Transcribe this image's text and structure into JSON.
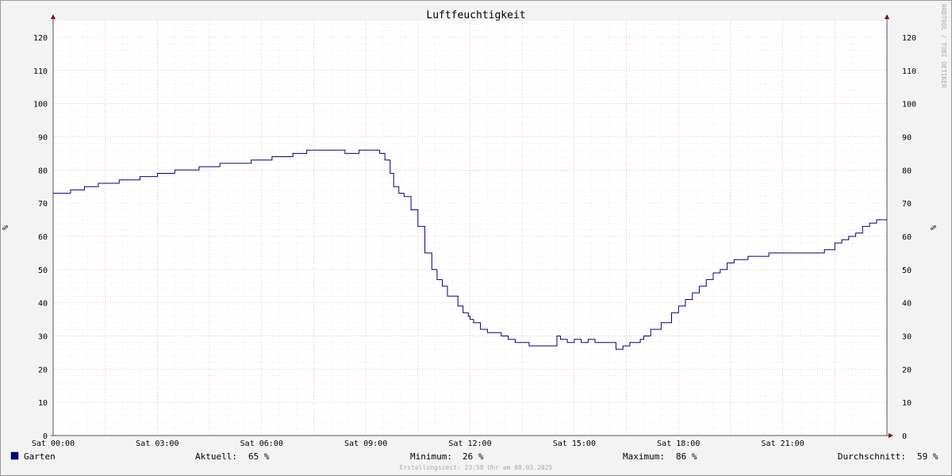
{
  "watermark": "RRDTOOL / TOBI OETIKER",
  "legend": {
    "series_name": "Garten",
    "current_label": "Aktuell:",
    "current_value": "65 %",
    "min_label": "Minimum:",
    "min_value": "26 %",
    "max_label": "Maximum:",
    "max_value": "86 %",
    "avg_label": "Durchschnitt:",
    "avg_value": "59 %"
  },
  "footer": "Erstellungszeit: 23:58 Uhr am 08.03.2025",
  "chart_data": {
    "type": "line",
    "title": "Luftfeuchtigkeit",
    "ylabel": "%",
    "ylabel_right": "%",
    "xlim": [
      0,
      24
    ],
    "ylim": [
      0,
      125
    ],
    "yticks": [
      0,
      10,
      20,
      30,
      40,
      50,
      60,
      70,
      80,
      90,
      100,
      110,
      120
    ],
    "xticks": [
      {
        "value": 0,
        "label": "Sat 00:00"
      },
      {
        "value": 3,
        "label": "Sat 03:00"
      },
      {
        "value": 6,
        "label": "Sat 06:00"
      },
      {
        "value": 9,
        "label": "Sat 09:00"
      },
      {
        "value": 12,
        "label": "Sat 12:00"
      },
      {
        "value": 15,
        "label": "Sat 15:00"
      },
      {
        "value": 18,
        "label": "Sat 18:00"
      },
      {
        "value": 21,
        "label": "Sat 21:00"
      }
    ],
    "grid": true,
    "series": [
      {
        "name": "Garten",
        "color": "#000080",
        "x": [
          0,
          0.15,
          0.5,
          0.9,
          1.3,
          1.9,
          2.5,
          3.0,
          3.5,
          4.2,
          4.8,
          5.7,
          6.3,
          6.9,
          7.3,
          8.0,
          8.4,
          8.8,
          9.2,
          9.4,
          9.55,
          9.7,
          9.8,
          9.95,
          10.1,
          10.3,
          10.5,
          10.7,
          10.9,
          11.05,
          11.2,
          11.35,
          11.5,
          11.65,
          11.8,
          11.95,
          12.0,
          12.1,
          12.3,
          12.5,
          12.7,
          12.9,
          13.1,
          13.3,
          13.5,
          13.7,
          13.9,
          14.2,
          14.5,
          14.6,
          14.8,
          15.0,
          15.2,
          15.4,
          15.6,
          15.8,
          16.0,
          16.2,
          16.4,
          16.6,
          16.8,
          16.9,
          17.0,
          17.2,
          17.5,
          17.8,
          18.0,
          18.2,
          18.4,
          18.6,
          18.8,
          19.0,
          19.2,
          19.4,
          19.6,
          19.8,
          20.0,
          20.3,
          20.6,
          21.0,
          21.5,
          22.2,
          22.5,
          22.7,
          22.9,
          23.1,
          23.3,
          23.5,
          23.7,
          23.85,
          24.0
        ],
        "y": [
          73,
          73,
          74,
          75,
          76,
          77,
          78,
          79,
          80,
          81,
          82,
          83,
          84,
          85,
          86,
          86,
          85,
          86,
          86,
          85,
          83,
          79,
          75,
          73,
          72,
          68,
          63,
          55,
          50,
          47,
          45,
          42,
          42,
          39,
          37,
          36,
          35,
          34,
          32,
          31,
          31,
          30,
          29,
          28,
          28,
          27,
          27,
          27,
          30,
          29,
          28,
          29,
          28,
          29,
          28,
          28,
          28,
          26,
          27,
          28,
          28,
          29,
          30,
          32,
          34,
          37,
          39,
          41,
          43,
          45,
          47,
          49,
          50,
          52,
          53,
          53,
          54,
          54,
          55,
          55,
          55,
          56,
          58,
          59,
          60,
          61,
          63,
          64,
          65,
          65,
          65
        ]
      }
    ]
  }
}
